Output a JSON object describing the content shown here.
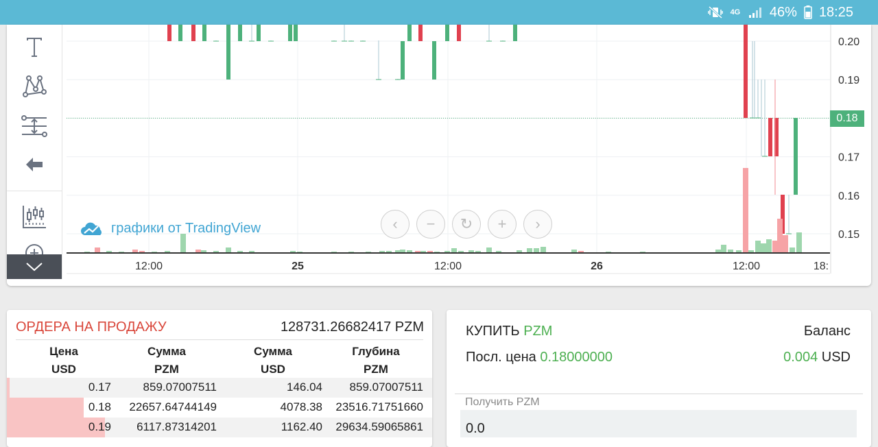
{
  "statusbar": {
    "network": "4G",
    "battery_pct": "46%",
    "time": "18:25"
  },
  "chart": {
    "watermark": "графики от TradingView",
    "current_price": "0.18",
    "price_ticks": [
      "0.20",
      "0.19",
      "0.18",
      "0.17",
      "0.16",
      "0.15"
    ],
    "time_ticks": [
      {
        "label": "12:00",
        "bold": false
      },
      {
        "label": "25",
        "bold": true
      },
      {
        "label": "12:00",
        "bold": false
      },
      {
        "label": "26",
        "bold": true
      },
      {
        "label": "12:00",
        "bold": false
      },
      {
        "label": "18:",
        "bold": false
      }
    ],
    "colors": {
      "up": "#4db17b",
      "down": "#e0414f",
      "vol_up": "#9ed6ad",
      "vol_down": "#f6a3a6",
      "axis": "#333333"
    }
  },
  "sell_orders": {
    "title": "ОРДЕРА НА ПРОДАЖУ",
    "total": "128731.26682417 PZM",
    "columns": [
      {
        "line1": "Цена",
        "line2": "USD"
      },
      {
        "line1": "Сумма",
        "line2": "PZM"
      },
      {
        "line1": "Сумма",
        "line2": "USD"
      },
      {
        "line1": "Глубина",
        "line2": "PZM"
      }
    ],
    "rows": [
      {
        "price": "0.17",
        "amount_pzm": "859.07007511",
        "amount_usd": "146.04",
        "depth": "859.07007511",
        "depth_fraction": 0.007
      },
      {
        "price": "0.18",
        "amount_pzm": "22657.64744149",
        "amount_usd": "4078.38",
        "depth": "23516.71751660",
        "depth_fraction": 0.18
      },
      {
        "price": "0.19",
        "amount_pzm": "6117.87314201",
        "amount_usd": "1162.40",
        "depth": "29634.59065861",
        "depth_fraction": 0.23
      }
    ]
  },
  "buy": {
    "title_prefix": "КУПИТЬ",
    "title_asset": "PZM",
    "balance_label": "Баланс",
    "last_price_label": "Посл. цена",
    "last_price_value": "0.18000000",
    "balance_value": "0.004",
    "balance_unit": "USD",
    "receive_label": "Получить PZM",
    "receive_value": "0.0"
  }
}
